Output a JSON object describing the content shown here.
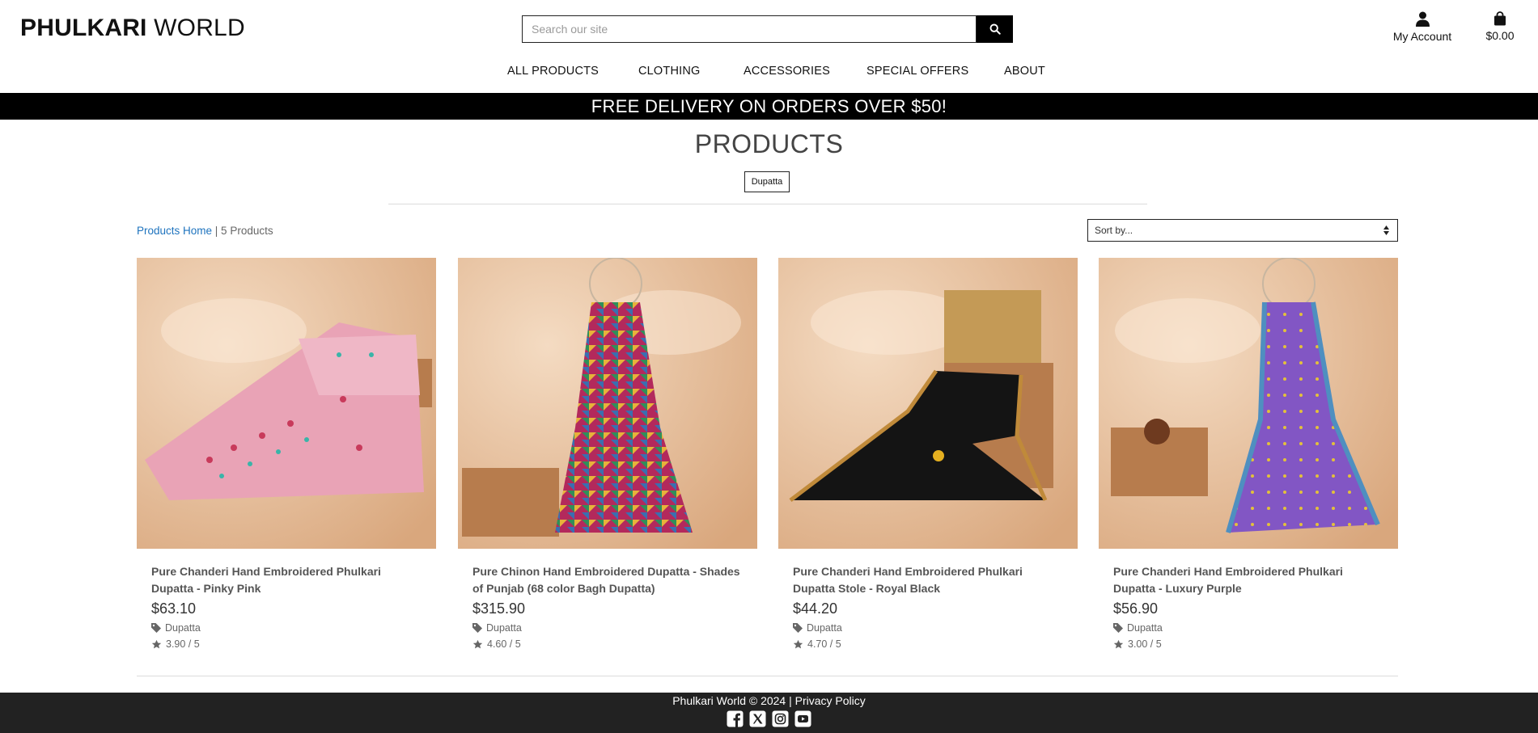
{
  "header": {
    "logo_bold": "PHULKARI",
    "logo_light": " WORLD",
    "search_placeholder": "Search our site",
    "account_label": "My Account",
    "bag_total": "$0.00"
  },
  "nav": {
    "items": [
      "ALL PRODUCTS",
      "CLOTHING",
      "ACCESSORIES",
      "SPECIAL OFFERS",
      "ABOUT"
    ]
  },
  "banner": {
    "text": "FREE DELIVERY ON ORDERS OVER $50!"
  },
  "main": {
    "title": "PRODUCTS",
    "category_tag": "Dupatta",
    "breadcrumb_link": "Products Home",
    "breadcrumb_count": " | 5 Products",
    "sort_label": "Sort by..."
  },
  "products": [
    {
      "name": "Pure Chanderi Hand Embroidered Phulkari Dupatta - Pinky Pink",
      "price": "$63.10",
      "category": "Dupatta",
      "rating": "3.90 / 5",
      "color": "#e9a3b6"
    },
    {
      "name": "Pure Chinon Hand Embroidered Dupatta - Shades of Punjab (68 color Bagh Dupatta)",
      "price": "$315.90",
      "category": "Dupatta",
      "rating": "4.60 / 5",
      "color": "#b3295c"
    },
    {
      "name": "Pure Chanderi Hand Embroidered Phulkari Dupatta Stole - Royal Black",
      "price": "$44.20",
      "category": "Dupatta",
      "rating": "4.70 / 5",
      "color": "#141414"
    },
    {
      "name": "Pure Chanderi Hand Embroidered Phulkari Dupatta - Luxury Purple",
      "price": "$56.90",
      "category": "Dupatta",
      "rating": "3.00 / 5",
      "color": "#8256c4"
    }
  ],
  "footer": {
    "copyright": "Phulkari World © 2024 | ",
    "privacy": "Privacy Policy",
    "social_icons": [
      "facebook-icon",
      "x-icon",
      "instagram-icon",
      "youtube-icon"
    ]
  },
  "colors": {
    "banner_bg": "#000000",
    "footer_bg": "#222222",
    "link": "#1e73be"
  }
}
